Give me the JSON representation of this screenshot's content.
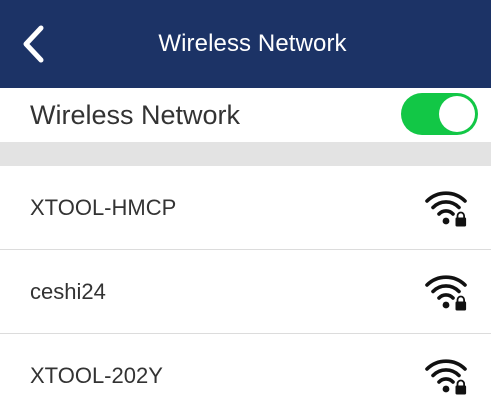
{
  "header": {
    "title": "Wireless Network",
    "back_icon": "chevron-left-icon"
  },
  "wireless_toggle": {
    "label": "Wireless Network",
    "enabled": true,
    "on_color": "#12c746"
  },
  "networks": [
    {
      "ssid": "XTOOL-HMCP",
      "icon": "wifi-locked-icon",
      "secured": true
    },
    {
      "ssid": "ceshi24",
      "icon": "wifi-locked-icon",
      "secured": true
    },
    {
      "ssid": "XTOOL-202Y",
      "icon": "wifi-locked-icon",
      "secured": true
    }
  ],
  "colors": {
    "header_bg": "#1c3366",
    "separator": "#e3e3e3",
    "text": "#333333"
  }
}
